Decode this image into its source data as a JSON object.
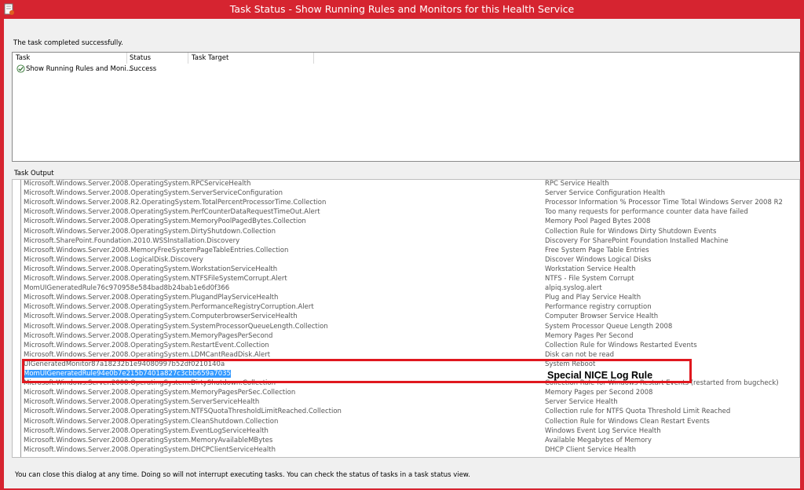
{
  "window": {
    "title": "Task Status - Show Running Rules and Monitors for this Health Service"
  },
  "status_message": "The task completed successfully.",
  "task_grid": {
    "columns": [
      "Task",
      "Status",
      "Task Target"
    ],
    "rows": [
      {
        "task": "Show Running Rules and Moni...",
        "status": "Success",
        "target": ""
      }
    ]
  },
  "output": {
    "label": "Task Output",
    "rows": [
      {
        "name": "Microsoft.Windows.Server.2008.OperatingSystem.RPCServiceHealth",
        "desc": "RPC Service Health"
      },
      {
        "name": "Microsoft.Windows.Server.2008.OperatingSystem.ServerServiceConfiguration",
        "desc": "Server Service Configuration Health"
      },
      {
        "name": "Microsoft.Windows.Server.2008.R2.OperatingSystem.TotalPercentProcessorTime.Collection",
        "desc": "Processor Information % Processor Time Total Windows Server 2008 R2"
      },
      {
        "name": "Microsoft.Windows.Server.2008.OperatingSystem.PerfCounterDataRequestTimeOut.Alert",
        "desc": "Too many requests for performance counter data have failed"
      },
      {
        "name": "Microsoft.Windows.Server.2008.OperatingSystem.MemoryPoolPagedBytes.Collection",
        "desc": "Memory Pool Paged Bytes 2008"
      },
      {
        "name": "Microsoft.Windows.Server.2008.OperatingSystem.DirtyShutdown.Collection",
        "desc": "Collection Rule for Windows Dirty Shutdown Events"
      },
      {
        "name": "Microsoft.SharePoint.Foundation.2010.WSSInstallation.Discovery",
        "desc": "Discovery For SharePoint Foundation Installed Machine"
      },
      {
        "name": "Microsoft.Windows.Server.2008.MemoryFreeSystemPageTableEntries.Collection",
        "desc": "Free System Page Table Entries"
      },
      {
        "name": "Microsoft.Windows.Server.2008.LogicalDisk.Discovery",
        "desc": "Discover Windows Logical Disks"
      },
      {
        "name": "Microsoft.Windows.Server.2008.OperatingSystem.WorkstationServiceHealth",
        "desc": "Workstation Service Health"
      },
      {
        "name": "Microsoft.Windows.Server.2008.OperatingSystem.NTFSFileSystemCorrupt.Alert",
        "desc": "NTFS - File System Corrupt"
      },
      {
        "name": "MomUIGeneratedRule76c970958e584bad8b24bab1e6d0f366",
        "desc": "alpiq.syslog.alert"
      },
      {
        "name": "Microsoft.Windows.Server.2008.OperatingSystem.PlugandPlayServiceHealth",
        "desc": "Plug and Play Service Health"
      },
      {
        "name": "Microsoft.Windows.Server.2008.OperatingSystem.PerformanceRegistryCorruption.Alert",
        "desc": "Performance registry corruption"
      },
      {
        "name": "Microsoft.Windows.Server.2008.OperatingSystem.ComputerbrowserServiceHealth",
        "desc": "Computer Browser Service Health"
      },
      {
        "name": "Microsoft.Windows.Server.2008.OperatingSystem.SystemProcessorQueueLength.Collection",
        "desc": "System Processor Queue Length 2008"
      },
      {
        "name": "Microsoft.Windows.Server.2008.OperatingSystem.MemoryPagesPerSecond",
        "desc": "Memory Pages Per Second"
      },
      {
        "name": "Microsoft.Windows.Server.2008.OperatingSystem.RestartEvent.Collection",
        "desc": "Collection Rule for Windows Restarted Events"
      },
      {
        "name": "Microsoft.Windows.Server.2008.OperatingSystem.LDMCantReadDisk.Alert",
        "desc": "Disk can not be read"
      },
      {
        "name": "UIGeneratedMonitor87a18232b1e94080997b52df0210140a",
        "desc": "System Reboot"
      },
      {
        "name": "MomUIGeneratedRule94e0b7e215b7401a827c3cbb659a7035",
        "desc": "",
        "selected": true
      },
      {
        "name": "Microsoft.Windows.Server.2008.OperatingSystem.DirtyShutdown.Collection",
        "desc": "Collection Rule for Windows Restart Events (restarted from bugcheck)"
      },
      {
        "name": "Microsoft.Windows.Server.2008.OperatingSystem.MemoryPagesPerSec.Collection",
        "desc": "Memory Pages per Second 2008"
      },
      {
        "name": "Microsoft.Windows.Server.2008.OperatingSystem.ServerServiceHealth",
        "desc": "Server Service Health"
      },
      {
        "name": "Microsoft.Windows.Server.2008.OperatingSystem.NTFSQuotaThresholdLimitReached.Collection",
        "desc": "Collection rule for NTFS Quota Threshold Limit Reached"
      },
      {
        "name": "Microsoft.Windows.Server.2008.OperatingSystem.CleanShutdown.Collection",
        "desc": "Collection Rule for Windows Clean Restart Events"
      },
      {
        "name": "Microsoft.Windows.Server.2008.OperatingSystem.EventLogServiceHealth",
        "desc": "Windows Event Log Service Health"
      },
      {
        "name": "Microsoft.Windows.Server.2008.OperatingSystem.MemoryAvailableMBytes",
        "desc": "Available Megabytes of Memory"
      },
      {
        "name": "Microsoft.Windows.Server.2008.OperatingSystem.DHCPClientServiceHealth",
        "desc": "DHCP Client Service Health"
      }
    ],
    "annotation": "Special NICE Log Rule"
  },
  "footer": "You can close this dialog at any time. Doing so will not interrupt executing tasks. You can check the status of tasks in a task status view.",
  "colors": {
    "frame": "#d62430",
    "selection": "#3399ff",
    "highlight_box": "#e0181f"
  }
}
